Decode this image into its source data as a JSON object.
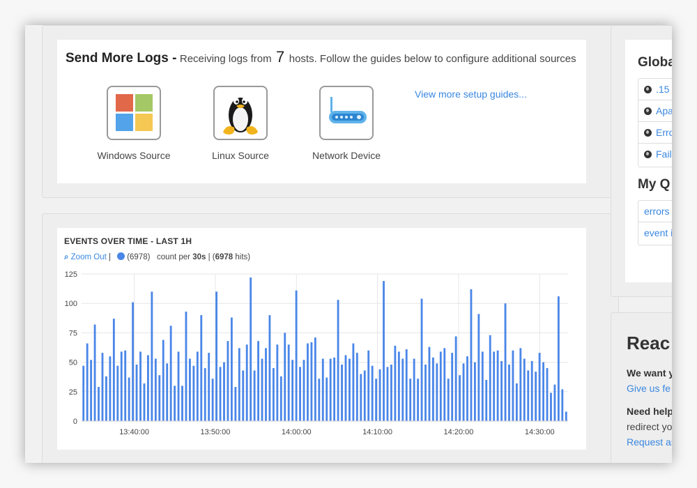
{
  "send_logs": {
    "title": "Send More Logs -",
    "text_before": "Receiving logs from",
    "host_count": "7",
    "text_after": "hosts. Follow the guides below to configure additional sources",
    "sources": [
      {
        "label": "Windows Source",
        "icon": "windows-icon"
      },
      {
        "label": "Linux Source",
        "icon": "linux-penguin-icon"
      },
      {
        "label": "Network Device",
        "icon": "router-icon"
      }
    ],
    "more_link": "View more setup guides..."
  },
  "chart": {
    "zoom_label": "Zoom Out",
    "legend_count": "(6978)",
    "count_prefix": "count per",
    "interval": "30s",
    "hits_open": "| (",
    "hits": "6978",
    "hits_suffix": "hits)",
    "series_color": "#4a86e8"
  },
  "chart_data": {
    "type": "bar",
    "title": "EVENTS OVER TIME - LAST 1H",
    "xlabel": "",
    "ylabel": "",
    "ylim": [
      0,
      125
    ],
    "yticks": [
      0,
      25,
      50,
      75,
      100,
      125
    ],
    "xlim": [
      "13:33:30",
      "14:33:30"
    ],
    "xticks": [
      "13:40:00",
      "13:50:00",
      "14:00:00",
      "14:10:00",
      "14:20:00",
      "14:30:00"
    ],
    "grid": true,
    "values": [
      47,
      66,
      52,
      82,
      29,
      58,
      38,
      55,
      87,
      47,
      59,
      60,
      37,
      101,
      48,
      59,
      32,
      56,
      110,
      53,
      39,
      69,
      49,
      81,
      30,
      59,
      30,
      93,
      53,
      47,
      59,
      90,
      45,
      58,
      36,
      110,
      46,
      50,
      68,
      88,
      29,
      62,
      43,
      65,
      122,
      43,
      68,
      53,
      62,
      90,
      45,
      65,
      38,
      75,
      65,
      52,
      111,
      46,
      52,
      66,
      67,
      71,
      36,
      53,
      37,
      53,
      54,
      103,
      48,
      56,
      53,
      66,
      58,
      40,
      43,
      60,
      47,
      36,
      44,
      119,
      46,
      48,
      64,
      59,
      53,
      61,
      36,
      53,
      36,
      104,
      48,
      63,
      54,
      49,
      59,
      62,
      36,
      58,
      72,
      39,
      49,
      55,
      112,
      50,
      91,
      59,
      35,
      73,
      59,
      60,
      51,
      100,
      48,
      60,
      32,
      62,
      53,
      43,
      51,
      42,
      58,
      50,
      45,
      24,
      31,
      106,
      27,
      8
    ]
  },
  "right_column": {
    "global_title": "Globa",
    "global_items": [
      ".15",
      "Apa",
      "Erro",
      "Fail"
    ],
    "my_title": "My Q",
    "my_items": [
      "errors a",
      "event i"
    ],
    "reach": {
      "title": "Reac",
      "line1": "We want y",
      "line2": "Give us fe",
      "line3": "Need help",
      "line4": "redirect yo",
      "line5": "Request as"
    }
  }
}
